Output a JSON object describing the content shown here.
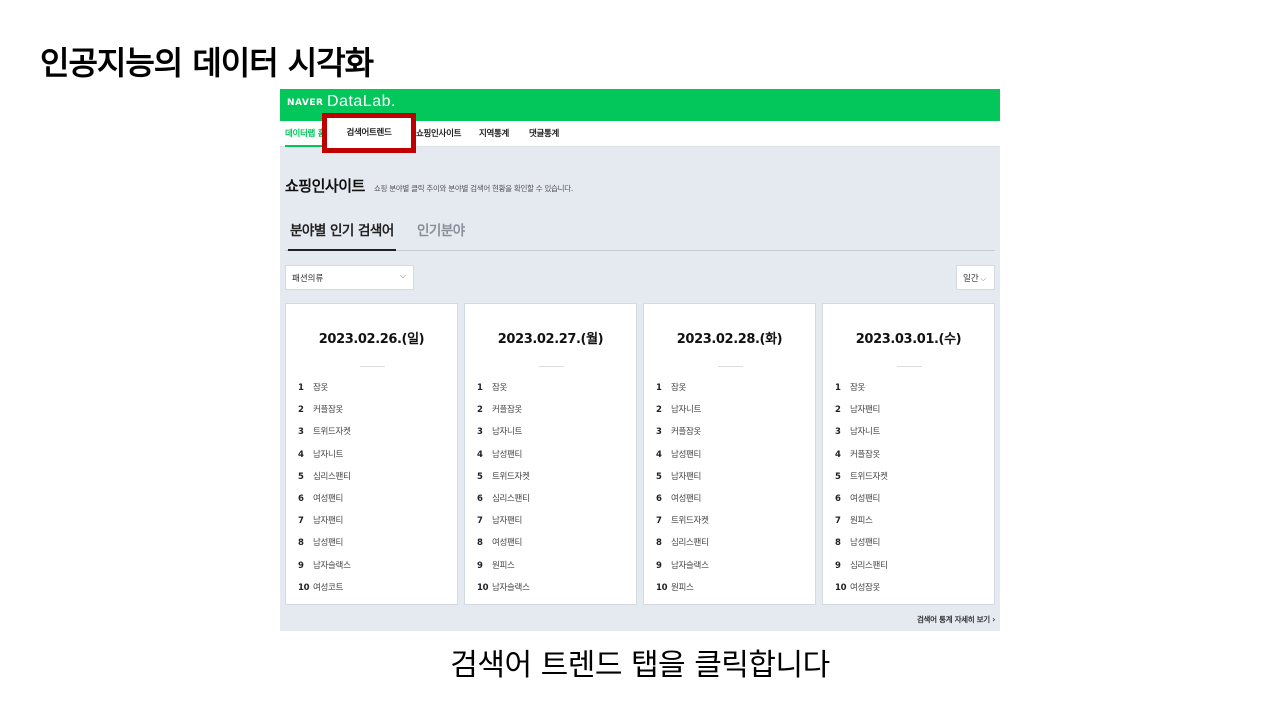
{
  "slide": {
    "title": "인공지능의 데이터 시각화",
    "caption": "검색어 트렌드 탭을 클릭합니다"
  },
  "header": {
    "brand": "NAVER",
    "product": "DataLab.",
    "brand_color": "#03c75a"
  },
  "gnb": {
    "items": [
      {
        "label": "데이터랩 홈",
        "active": true
      },
      {
        "label": "검색어트렌드",
        "highlighted": true
      },
      {
        "label": "쇼핑인사이트"
      },
      {
        "label": "지역통계"
      },
      {
        "label": "댓글통계"
      }
    ]
  },
  "section": {
    "title": "쇼핑인사이트",
    "desc": "쇼핑 분야별 클릭 추이와 분야별 검색어 현황을 확인할 수 있습니다."
  },
  "tabs": [
    "분야별 인기 검색어",
    "인기분야"
  ],
  "filters": {
    "category": "패션의류",
    "period": "일간"
  },
  "cards": [
    {
      "date": "2023.02.26.(일)",
      "items": [
        "잠옷",
        "커플잠옷",
        "트위드자켓",
        "남자니트",
        "심리스팬티",
        "여성팬티",
        "남자팬티",
        "남성팬티",
        "남자슬랙스",
        "여성코트"
      ]
    },
    {
      "date": "2023.02.27.(월)",
      "items": [
        "잠옷",
        "커플잠옷",
        "남자니트",
        "남성팬티",
        "트위드자켓",
        "심리스팬티",
        "남자팬티",
        "여성팬티",
        "원피스",
        "남자슬랙스"
      ]
    },
    {
      "date": "2023.02.28.(화)",
      "items": [
        "잠옷",
        "남자니트",
        "커플잠옷",
        "남성팬티",
        "남자팬티",
        "여성팬티",
        "트위드자켓",
        "심리스팬티",
        "남자슬랙스",
        "원피스"
      ]
    },
    {
      "date": "2023.03.01.(수)",
      "items": [
        "잠옷",
        "남자팬티",
        "남자니트",
        "커플잠옷",
        "트위드자켓",
        "여성팬티",
        "원피스",
        "남성팬티",
        "심리스팬티",
        "여성잠옷"
      ]
    }
  ],
  "more_link": "검색어 통계 자세히 보기"
}
